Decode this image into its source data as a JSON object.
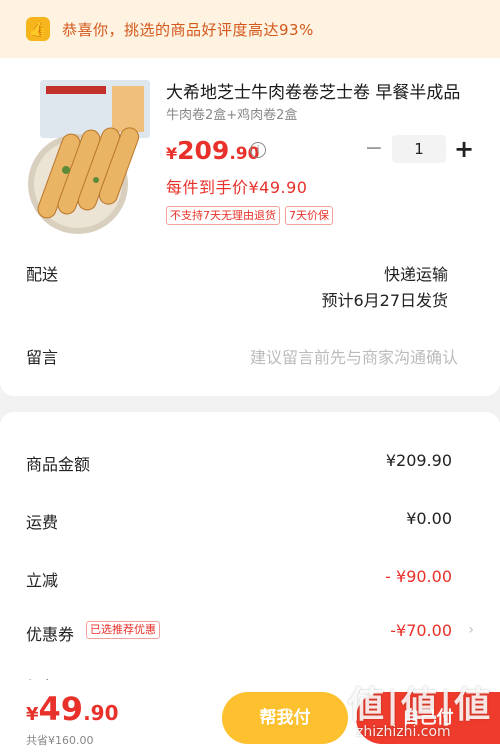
{
  "banner": {
    "text": "恭喜你，挑选的商品好评度高达93%"
  },
  "product": {
    "title": "大希地芝士牛肉卷卷芝士卷 早餐半成品",
    "spec": "牛肉卷2盒+鸡肉卷2盒",
    "price_symbol": "¥",
    "price_int": "209",
    "price_dec": ".90",
    "quantity": "1",
    "unit_price": "每件到手价¥49.90",
    "tags": [
      "不支持7天无理由退货",
      "7天价保"
    ]
  },
  "delivery": {
    "label": "配送",
    "method": "快递运输",
    "eta": "预计6月27日发货"
  },
  "message": {
    "label": "留言",
    "placeholder": "建议留言前先与商家沟通确认"
  },
  "summary": {
    "goods_label": "商品金额",
    "goods_value": "¥209.90",
    "shipping_label": "运费",
    "shipping_value": "¥0.00",
    "discount_label": "立减",
    "discount_value": "- ¥90.00",
    "coupon_label": "优惠券",
    "coupon_tag": "已选推荐优惠",
    "coupon_value": "-¥70.00",
    "redpacket_label": "红包"
  },
  "bottom": {
    "total_symbol": "¥",
    "total_int": "49",
    "total_dec": ".90",
    "subtotal": "共省¥160.00",
    "help_btn": "帮我付",
    "pay_btn": "自己付"
  },
  "watermark": {
    "big": "値|値|値",
    "small": "zhizhizhi.com"
  },
  "colors": {
    "accent_red": "#e8312a",
    "yellow_btn": "#fdc02e",
    "banner_bg": "#fdf3e0"
  }
}
